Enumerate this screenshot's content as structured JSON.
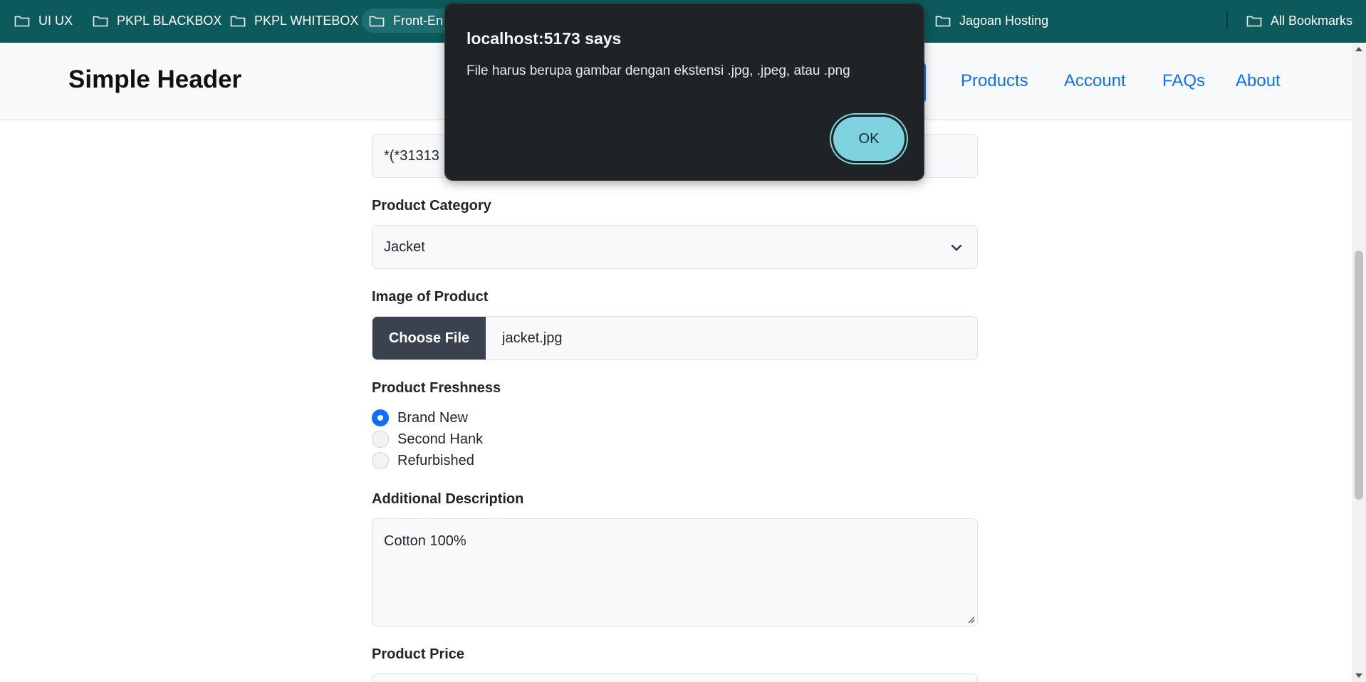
{
  "bookmarks": {
    "items": [
      {
        "label": "UI UX"
      },
      {
        "label": "PKPL BLACKBOX"
      },
      {
        "label": "PKPL WHITEBOX"
      },
      {
        "label": "Front-En"
      },
      {
        "label": "Jagoan Hosting"
      }
    ],
    "all_label": "All Bookmarks"
  },
  "header": {
    "brand": "Simple Header",
    "nav": [
      "Products",
      "Account",
      "FAQs",
      "About"
    ]
  },
  "form": {
    "name_value": "*(*31313",
    "category_label": "Product Category",
    "category_value": "Jacket",
    "image_label": "Image of Product",
    "choose_file_label": "Choose File",
    "file_name": "jacket.jpg",
    "freshness_label": "Product Freshness",
    "freshness_options": [
      "Brand New",
      "Second Hank",
      "Refurbished"
    ],
    "freshness_selected": "Brand New",
    "description_label": "Additional Description",
    "description_value": "Cotton 100%",
    "price_label": "Product Price"
  },
  "dialog": {
    "title": "localhost:5173 says",
    "message": "File harus berupa gambar dengan ekstensi .jpg, .jpeg, atau .png",
    "ok_label": "OK"
  },
  "colors": {
    "bookmarks_bg": "#0c5a5c",
    "accent": "#0d6efd",
    "dialog_bg": "#1f2326",
    "ok_button": "#7fd3e0",
    "file_button": "#3a4250"
  }
}
